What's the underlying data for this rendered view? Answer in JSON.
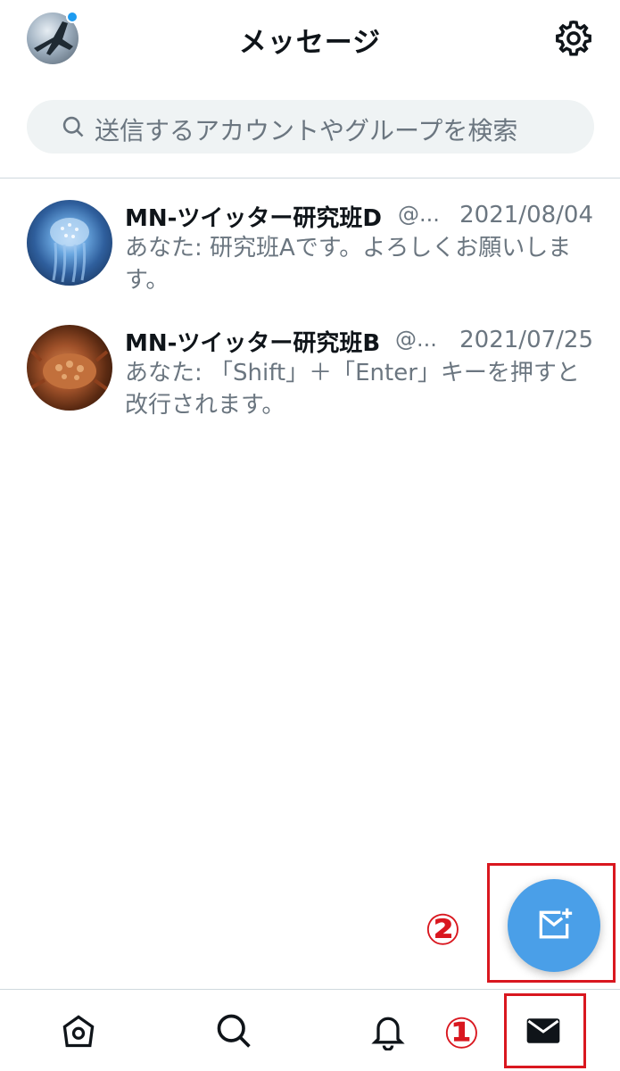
{
  "header": {
    "title": "メッセージ",
    "avatar_icon": "profile-avatar",
    "settings_icon": "gear-icon"
  },
  "search": {
    "placeholder": "送信するアカウントやグループを検索",
    "icon": "search-icon"
  },
  "conversations": [
    {
      "name": "MN-ツイッター研究班D",
      "handle": "@...",
      "date": "2021/08/04",
      "preview": "あなた: 研究班Aです。よろしくお願いします。"
    },
    {
      "name": "MN-ツイッター研究班B",
      "handle": "@...",
      "date": "2021/07/25",
      "preview": "あなた: 「Shift」＋「Enter」キーを押すと改行されます。"
    }
  ],
  "annotations": {
    "compose": "②",
    "messages_tab": "①"
  },
  "bottom_nav": [
    "home-icon",
    "search-icon",
    "bell-icon",
    "mail-icon"
  ],
  "colors": {
    "accent": "#4a9fe8",
    "annotation": "#d9171f",
    "secondary_text": "#6b7680",
    "divider": "#cfd9de"
  }
}
